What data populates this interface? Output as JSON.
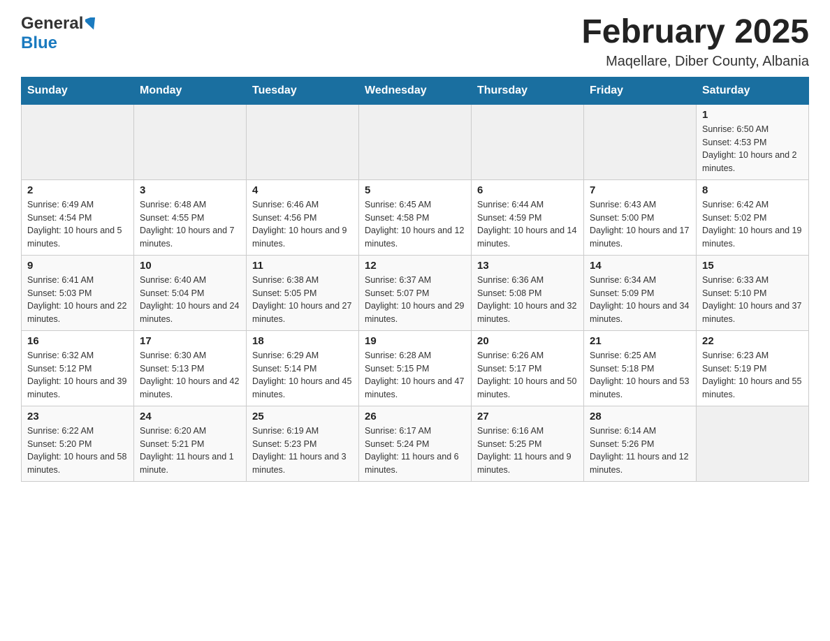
{
  "header": {
    "logo_general": "General",
    "logo_blue": "Blue",
    "month_title": "February 2025",
    "location": "Maqellare, Diber County, Albania"
  },
  "weekdays": [
    "Sunday",
    "Monday",
    "Tuesday",
    "Wednesday",
    "Thursday",
    "Friday",
    "Saturday"
  ],
  "weeks": [
    [
      {
        "day": "",
        "info": ""
      },
      {
        "day": "",
        "info": ""
      },
      {
        "day": "",
        "info": ""
      },
      {
        "day": "",
        "info": ""
      },
      {
        "day": "",
        "info": ""
      },
      {
        "day": "",
        "info": ""
      },
      {
        "day": "1",
        "info": "Sunrise: 6:50 AM\nSunset: 4:53 PM\nDaylight: 10 hours and 2 minutes."
      }
    ],
    [
      {
        "day": "2",
        "info": "Sunrise: 6:49 AM\nSunset: 4:54 PM\nDaylight: 10 hours and 5 minutes."
      },
      {
        "day": "3",
        "info": "Sunrise: 6:48 AM\nSunset: 4:55 PM\nDaylight: 10 hours and 7 minutes."
      },
      {
        "day": "4",
        "info": "Sunrise: 6:46 AM\nSunset: 4:56 PM\nDaylight: 10 hours and 9 minutes."
      },
      {
        "day": "5",
        "info": "Sunrise: 6:45 AM\nSunset: 4:58 PM\nDaylight: 10 hours and 12 minutes."
      },
      {
        "day": "6",
        "info": "Sunrise: 6:44 AM\nSunset: 4:59 PM\nDaylight: 10 hours and 14 minutes."
      },
      {
        "day": "7",
        "info": "Sunrise: 6:43 AM\nSunset: 5:00 PM\nDaylight: 10 hours and 17 minutes."
      },
      {
        "day": "8",
        "info": "Sunrise: 6:42 AM\nSunset: 5:02 PM\nDaylight: 10 hours and 19 minutes."
      }
    ],
    [
      {
        "day": "9",
        "info": "Sunrise: 6:41 AM\nSunset: 5:03 PM\nDaylight: 10 hours and 22 minutes."
      },
      {
        "day": "10",
        "info": "Sunrise: 6:40 AM\nSunset: 5:04 PM\nDaylight: 10 hours and 24 minutes."
      },
      {
        "day": "11",
        "info": "Sunrise: 6:38 AM\nSunset: 5:05 PM\nDaylight: 10 hours and 27 minutes."
      },
      {
        "day": "12",
        "info": "Sunrise: 6:37 AM\nSunset: 5:07 PM\nDaylight: 10 hours and 29 minutes."
      },
      {
        "day": "13",
        "info": "Sunrise: 6:36 AM\nSunset: 5:08 PM\nDaylight: 10 hours and 32 minutes."
      },
      {
        "day": "14",
        "info": "Sunrise: 6:34 AM\nSunset: 5:09 PM\nDaylight: 10 hours and 34 minutes."
      },
      {
        "day": "15",
        "info": "Sunrise: 6:33 AM\nSunset: 5:10 PM\nDaylight: 10 hours and 37 minutes."
      }
    ],
    [
      {
        "day": "16",
        "info": "Sunrise: 6:32 AM\nSunset: 5:12 PM\nDaylight: 10 hours and 39 minutes."
      },
      {
        "day": "17",
        "info": "Sunrise: 6:30 AM\nSunset: 5:13 PM\nDaylight: 10 hours and 42 minutes."
      },
      {
        "day": "18",
        "info": "Sunrise: 6:29 AM\nSunset: 5:14 PM\nDaylight: 10 hours and 45 minutes."
      },
      {
        "day": "19",
        "info": "Sunrise: 6:28 AM\nSunset: 5:15 PM\nDaylight: 10 hours and 47 minutes."
      },
      {
        "day": "20",
        "info": "Sunrise: 6:26 AM\nSunset: 5:17 PM\nDaylight: 10 hours and 50 minutes."
      },
      {
        "day": "21",
        "info": "Sunrise: 6:25 AM\nSunset: 5:18 PM\nDaylight: 10 hours and 53 minutes."
      },
      {
        "day": "22",
        "info": "Sunrise: 6:23 AM\nSunset: 5:19 PM\nDaylight: 10 hours and 55 minutes."
      }
    ],
    [
      {
        "day": "23",
        "info": "Sunrise: 6:22 AM\nSunset: 5:20 PM\nDaylight: 10 hours and 58 minutes."
      },
      {
        "day": "24",
        "info": "Sunrise: 6:20 AM\nSunset: 5:21 PM\nDaylight: 11 hours and 1 minute."
      },
      {
        "day": "25",
        "info": "Sunrise: 6:19 AM\nSunset: 5:23 PM\nDaylight: 11 hours and 3 minutes."
      },
      {
        "day": "26",
        "info": "Sunrise: 6:17 AM\nSunset: 5:24 PM\nDaylight: 11 hours and 6 minutes."
      },
      {
        "day": "27",
        "info": "Sunrise: 6:16 AM\nSunset: 5:25 PM\nDaylight: 11 hours and 9 minutes."
      },
      {
        "day": "28",
        "info": "Sunrise: 6:14 AM\nSunset: 5:26 PM\nDaylight: 11 hours and 12 minutes."
      },
      {
        "day": "",
        "info": ""
      }
    ]
  ]
}
